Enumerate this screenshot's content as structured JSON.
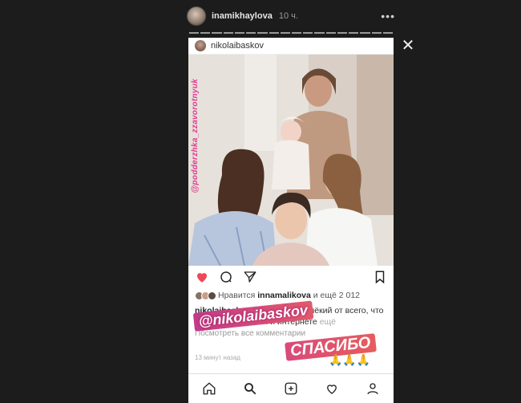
{
  "story": {
    "username": "inamikhaylova",
    "time": "10 ч.",
    "more_icon": "more-dots-icon",
    "close_icon": "close-icon",
    "segments": 18
  },
  "post": {
    "username": "nikolaibaskov",
    "photo_watermark": "@podderzhka_zzavorotnyuk",
    "likes_text_prefix": "Нравится",
    "likes_user": "innamalikova",
    "likes_text_suffix": "и ещё 2 012",
    "caption_user": "nikolaibaskov",
    "caption_text": "Я - человек далёкий от всего, что происходит в СМИ и интернете",
    "caption_more": "ещё",
    "view_comments": "Посмотреть все комментарии",
    "comment_preview": "",
    "time_ago": "13 минут назад"
  },
  "stickers": {
    "mention": "@nikolaibaskov",
    "thanks": "СПАСИБО",
    "emoji": "🙏🙏🙏"
  },
  "nav": [
    "home-icon",
    "search-icon",
    "add-post-icon",
    "activity-heart-icon",
    "profile-icon"
  ],
  "colors": {
    "background": "#1c1c1c",
    "like_red": "#ed4956",
    "sticker_pink": "#c23a8a"
  }
}
